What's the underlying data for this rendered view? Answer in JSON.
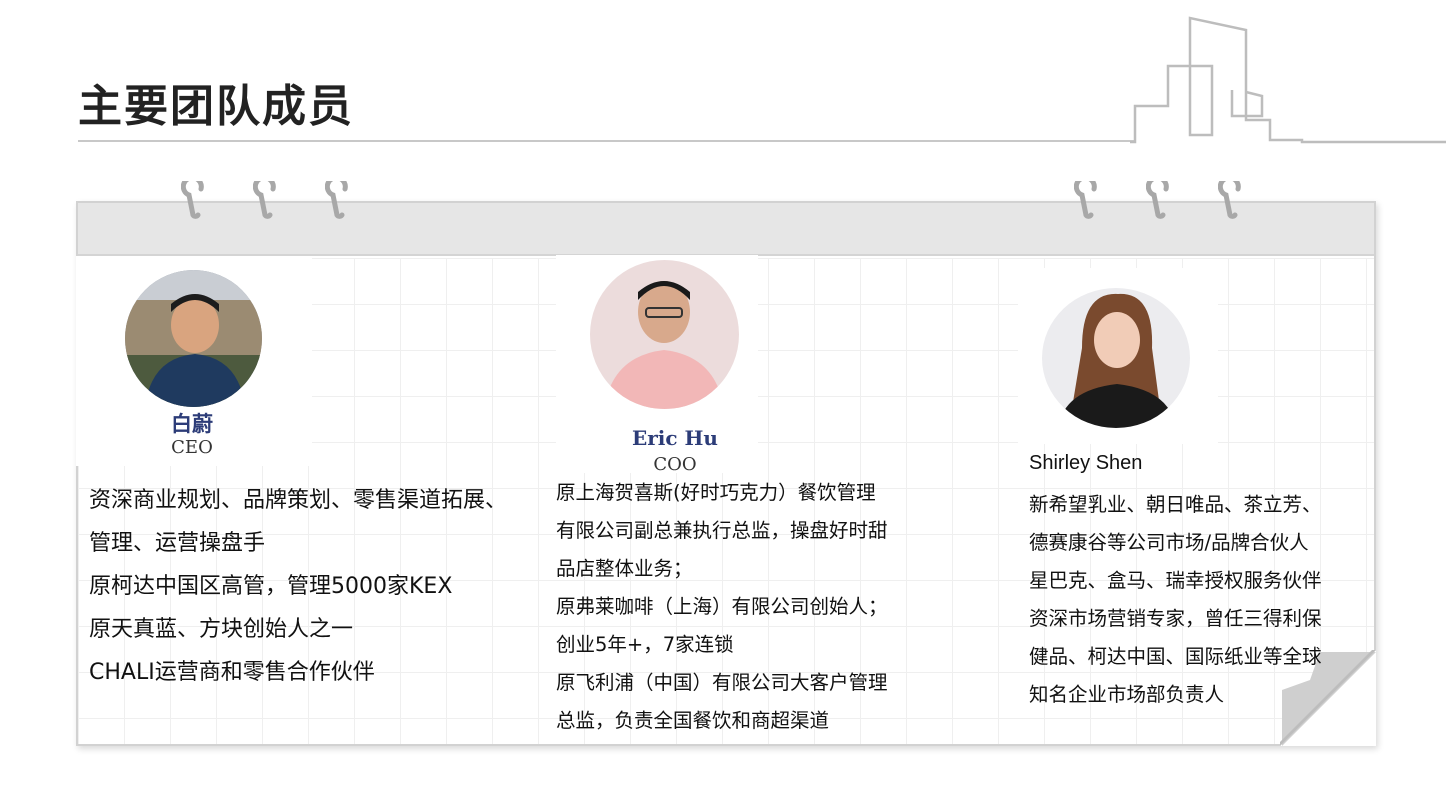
{
  "slide": {
    "title": "主要团队成员"
  },
  "members": [
    {
      "photo_name": "白蔚",
      "role": "CEO",
      "lines": [
        "资深商业规划、品牌策划、零售渠道拓展、",
        "管理、运营操盘手",
        "原柯达中国区高管，管理5000家KEX",
        "原天真蓝、方块创始人之一",
        "CHALI运营商和零售合作伙伴"
      ]
    },
    {
      "photo_name": "Eric Hu",
      "role": "COO",
      "lines": [
        "原上海贺喜斯(好时巧克力）餐饮管理",
        "有限公司副总兼执行总监，操盘好时甜",
        "品店整体业务；",
        "原弗莱咖啡（上海）有限公司创始人；",
        "创业5年+，7家连锁",
        "原飞利浦（中国）有限公司大客户管理",
        "总监，负责全国餐饮和商超渠道"
      ]
    },
    {
      "name": "Shirley Shen",
      "lines": [
        "新希望乳业、朝日唯品、茶立芳、",
        "德赛康谷等公司市场/品牌合伙人",
        "星巴克、盒马、瑞幸授权服务伙伴",
        "资深市场营销专家，曾任三得利保",
        "健品、柯达中国、国际纸业等全球",
        "知名企业市场部负责人"
      ]
    }
  ],
  "colors": {
    "title": "#222222",
    "caption_name": "#2c3c78",
    "card_header": "#e6e6e6",
    "card_border": "#d2d2d2"
  },
  "icons": [
    "skyline-icon",
    "binder-ring-icon",
    "page-curl-icon"
  ]
}
